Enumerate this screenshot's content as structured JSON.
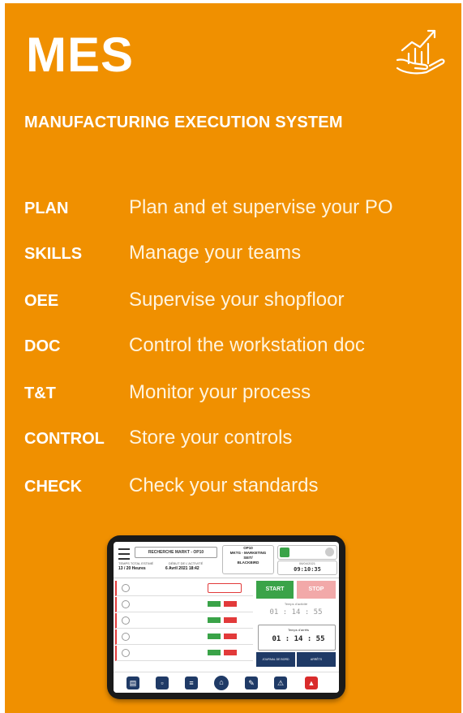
{
  "header": {
    "title": "MES",
    "subtitle": "MANUFACTURING EXECUTION SYSTEM",
    "logo_icon": "hand-growth-chart-icon"
  },
  "colors": {
    "background": "#f09000",
    "text": "#ffffff"
  },
  "features": [
    {
      "code": "PLAN",
      "description": "Plan and et supervise your PO"
    },
    {
      "code": "SKILLS",
      "description": "Manage your teams"
    },
    {
      "code": "OEE",
      "description": "Supervise your shopfloor"
    },
    {
      "code": "DOC",
      "description": "Control the workstation doc"
    },
    {
      "code": "T&T",
      "description": "Monitor your process"
    },
    {
      "code": "CONTROL",
      "description": "Store your controls"
    },
    {
      "code": "CHECK",
      "description": "Check your standards"
    }
  ],
  "tablet": {
    "search_label": "RECHERCHE MARKT - OP10",
    "total_label": "TEMPS TOTAL ESTIMÉ",
    "total_value": "13 / 20 Heures",
    "start_label": "DÉBUT DE L'ACTIVITÉ",
    "start_value": "6 Avril 2021 18:42",
    "op_line1": "OP10",
    "op_line2": "MKTG - MARKETING",
    "op_line3": "SEIT/",
    "op_line4": "BLACKBIRD",
    "date": "06/04/2021",
    "clock": "09:10:35",
    "start_button": "START",
    "stop_button": "STOP",
    "activity_label": "Temps d'activité",
    "activity_time": "01 : 14 : 55",
    "stop_time_label": "Temps d'arrêts",
    "stop_time": "01 : 14 : 55",
    "journal_button": "JOURNAL DE BORD",
    "stops_button": "ARRÊTS"
  }
}
